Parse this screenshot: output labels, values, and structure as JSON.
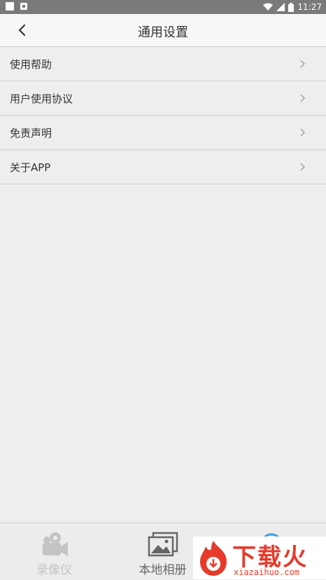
{
  "status_bar": {
    "time": "11:27"
  },
  "header": {
    "title": "通用设置"
  },
  "menu": {
    "items": [
      {
        "label": "使用帮助"
      },
      {
        "label": "用户使用协议"
      },
      {
        "label": "免责声明"
      },
      {
        "label": "关于APP"
      }
    ]
  },
  "bottom_nav": {
    "tabs": [
      {
        "label": "录像仪",
        "icon": "camcorder-icon"
      },
      {
        "label": "本地相册",
        "icon": "gallery-icon"
      },
      {
        "label": "",
        "icon": "settings-icon"
      }
    ]
  },
  "watermark": {
    "text": "下载火",
    "sub": "xiazaihuo.com"
  },
  "colors": {
    "background": "#eeeeee",
    "statusbar": "#7a7a7a",
    "watermark_red": "#e43b2b",
    "tab_inactive": "#c4c4c4",
    "tab_active": "#666666"
  }
}
